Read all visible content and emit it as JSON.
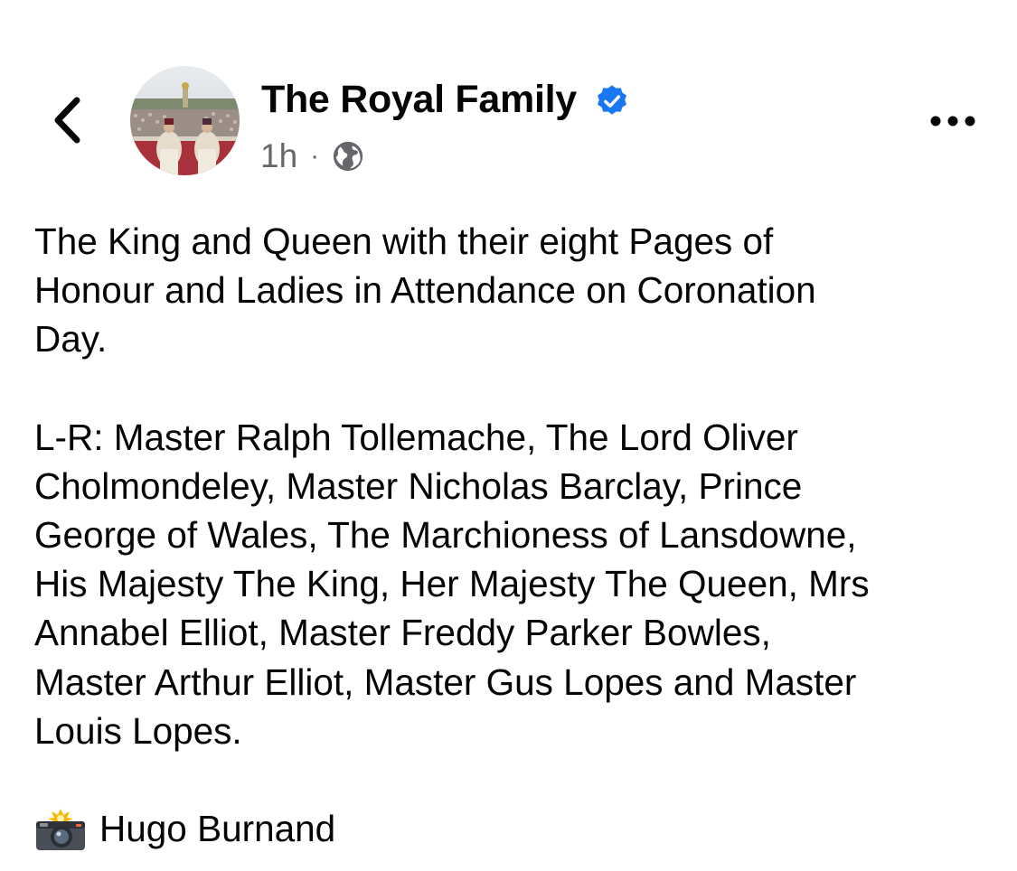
{
  "header": {
    "back_icon": "chevron-left-icon",
    "author_name": "The Royal Family",
    "verified_icon": "verified-badge-icon",
    "time": "1h",
    "separator": "·",
    "audience_icon": "globe-icon",
    "more_icon": "more-horizontal-icon"
  },
  "post": {
    "paragraph_1": "The King and Queen with their eight Pages of\nHonour and Ladies in Attendance on Coronation\nDay.",
    "paragraph_2": "L-R: Master Ralph Tollemache, The Lord Oliver\nCholmondeley, Master Nicholas Barclay, Prince\nGeorge of Wales, The Marchioness of Lansdowne,\nHis Majesty The King, Her Majesty The Queen, Mrs\nAnnabel Elliot, Master Freddy Parker Bowles,\nMaster Arthur Elliot, Master Gus Lopes and Master\nLouis Lopes.",
    "credit_icon": "camera-flash-icon",
    "credit_text": "Hugo Burnand"
  },
  "colors": {
    "text": "#050505",
    "secondary_text": "#65676b",
    "verified_blue": "#1877f2"
  }
}
